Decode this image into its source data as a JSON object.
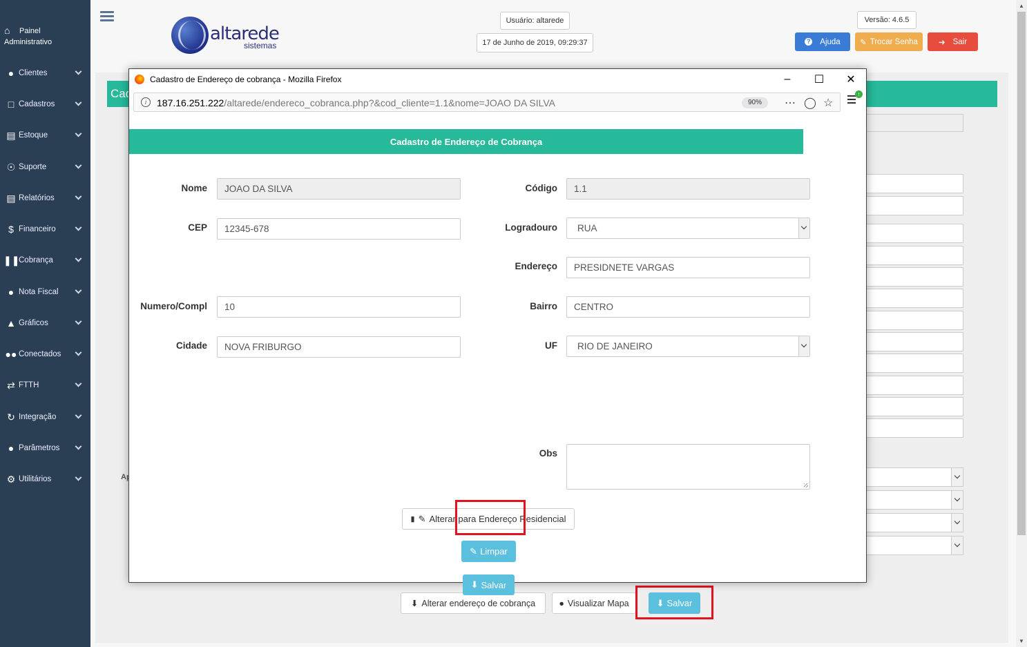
{
  "sidebar": {
    "painel_line1": "Painel",
    "painel_line2": "Administrativo",
    "items": [
      {
        "label": "Clientes",
        "icon": "user-icon"
      },
      {
        "label": "Cadastros",
        "icon": "folder-icon"
      },
      {
        "label": "Estoque",
        "icon": "printer-icon"
      },
      {
        "label": "Suporte",
        "icon": "lifebuoy-icon"
      },
      {
        "label": "Relatórios",
        "icon": "printer-icon"
      },
      {
        "label": "Financeiro",
        "icon": "dollar-icon"
      },
      {
        "label": "Cobrança",
        "icon": "barcode-icon"
      },
      {
        "label": "Nota Fiscal",
        "icon": "user-icon"
      },
      {
        "label": "Gráficos",
        "icon": "area-chart-icon"
      },
      {
        "label": "Conectados",
        "icon": "users-icon"
      },
      {
        "label": "FTTH",
        "icon": "random-icon"
      },
      {
        "label": "Integração",
        "icon": "retweet-icon"
      },
      {
        "label": "Parâmetros",
        "icon": "user-icon"
      },
      {
        "label": "Utilitários",
        "icon": "cogs-icon"
      }
    ]
  },
  "header": {
    "logo_text": "altarede",
    "logo_sub": "sistemas",
    "user": "Usuário: altarede",
    "datetime": "17 de Junho de 2019, 09:29:37",
    "version": "Versão: 4.6.5",
    "help_label": "Ajuda",
    "change_password_label": "Trocar Senha",
    "logout_label": "Sair"
  },
  "background": {
    "title_partial": "Cad",
    "label_partial": "Ap",
    "btn_alterar_cobranca": "Alterar endereço de cobrança",
    "btn_visualizar_mapa": "Visualizar Mapa",
    "btn_salvar": "Salvar"
  },
  "popup": {
    "window_title": "Cadastro de Endereço de cobrança - Mozilla Firefox",
    "url_host": "187.16.251.222",
    "url_path": "/altarede/endereco_cobranca.php?&cod_cliente=1.1&nome=JOAO DA SILVA",
    "zoom": "90%",
    "form_title": "Cadastro de Endereço de Cobrança",
    "fields": {
      "nome": {
        "label": "Nome",
        "value": "JOAO DA SILVA"
      },
      "codigo": {
        "label": "Código",
        "value": "1.1"
      },
      "cep": {
        "label": "CEP",
        "value": "12345-678"
      },
      "logradouro": {
        "label": "Logradouro",
        "value": "RUA"
      },
      "endereco": {
        "label": "Endereço",
        "value": "PRESIDNETE VARGAS"
      },
      "numero": {
        "label": "Numero/Compl",
        "value": "10"
      },
      "bairro": {
        "label": "Bairro",
        "value": "CENTRO"
      },
      "cidade": {
        "label": "Cidade",
        "value": "NOVA FRIBURGO"
      },
      "uf": {
        "label": "UF",
        "value": "RIO DE JANEIRO"
      },
      "obs": {
        "label": "Obs",
        "value": ""
      }
    },
    "btn_alterar_residencial": "Alterar para Endereço Residencial",
    "btn_limpar": "Limpar",
    "btn_salvar": "Salvar"
  },
  "colors": {
    "sidebar": "#2a3f54",
    "accent_green": "#26b99a",
    "info_blue": "#5bc0de",
    "help_blue": "#3a7bd5",
    "warning_orange": "#f0ad4e",
    "danger_red": "#e74c3c",
    "highlight_red": "#e3121e"
  }
}
